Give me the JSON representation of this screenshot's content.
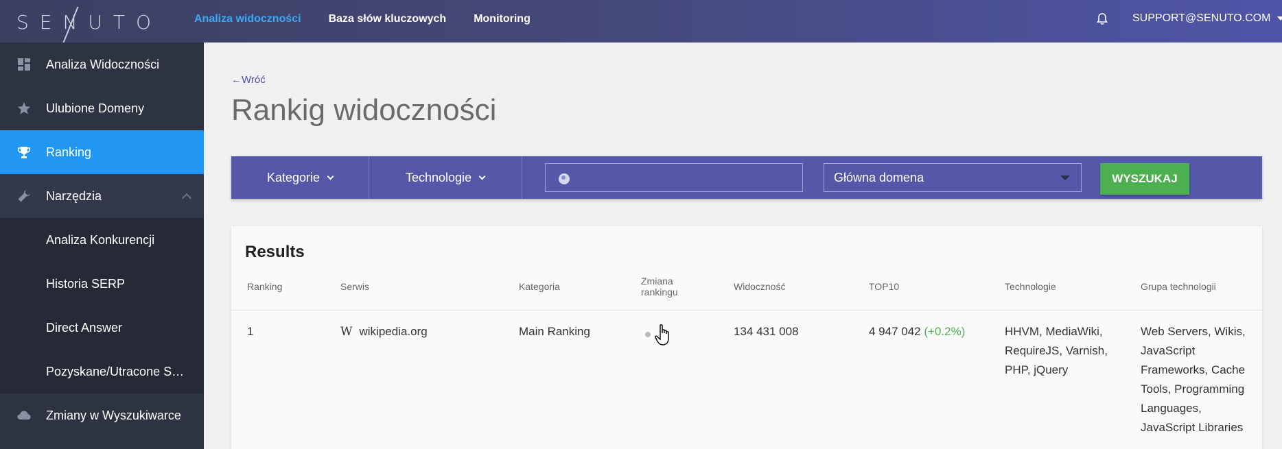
{
  "brand": {
    "logo_text": "SENUTO"
  },
  "topnav": {
    "items": [
      {
        "label": "Analiza widoczności",
        "active": true
      },
      {
        "label": "Baza słów kluczowych",
        "active": false
      },
      {
        "label": "Monitoring",
        "active": false
      }
    ],
    "user_email": "SUPPORT@SENUTO.COM",
    "icons": {
      "notifications": "bell-icon"
    }
  },
  "sidebar": {
    "items": [
      {
        "label": "Analiza Widoczności",
        "icon": "dashboard-icon"
      },
      {
        "label": "Ulubione Domeny",
        "icon": "star-icon"
      },
      {
        "label": "Ranking",
        "icon": "trophy-icon",
        "active": true
      },
      {
        "label": "Narzędzia",
        "icon": "wrench-icon",
        "expanded": true
      },
      {
        "label": "Analiza Konkurencji"
      },
      {
        "label": "Historia SERP"
      },
      {
        "label": "Direct Answer"
      },
      {
        "label": "Pozyskane/Utracone Słowa"
      },
      {
        "label": "Zmiany w Wyszukiwarce",
        "icon": "cloud-icon"
      }
    ]
  },
  "main": {
    "back_label": "Wróć",
    "title": "Rankig widoczności",
    "filters": {
      "categories_label": "Kategorie",
      "technologies_label": "Technologie",
      "search_value": "",
      "domain_select": "Główna domena",
      "search_button": "WYSZUKAJ"
    },
    "results": {
      "title": "Results",
      "columns": [
        "Ranking",
        "Serwis",
        "Kategoria",
        "Zmiana rankingu",
        "Widoczność",
        "TOP10",
        "Technologie",
        "Grupa technologii"
      ],
      "rows": [
        {
          "ranking": "1",
          "site": "wikipedia.org",
          "site_icon": "W",
          "category": "Main Ranking",
          "visibility": "134 431 008",
          "top10": "4 947 042",
          "top10_change": "(+0.2%)",
          "technologies": [
            "HHVM, MediaWiki,",
            "RequireJS, Varnish,",
            "PHP, jQuery"
          ],
          "tech_groups": [
            "Web Servers, Wikis,",
            "JavaScript",
            "Frameworks, Cache",
            "Tools, Programming",
            "Languages,",
            "JavaScript Libraries"
          ]
        }
      ]
    }
  },
  "colors": {
    "accent_blue": "#2196f3",
    "filter_bar": "#5558a8",
    "search_button": "#4caf50",
    "positive_change": "#4caf50"
  }
}
